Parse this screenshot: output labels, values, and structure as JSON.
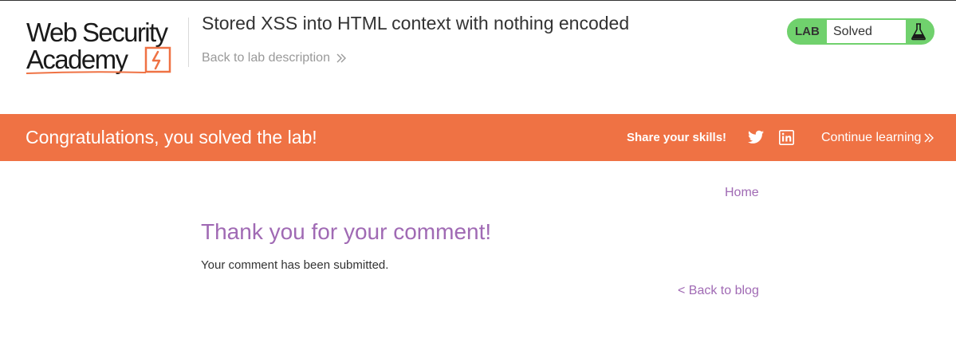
{
  "header": {
    "logo": {
      "line1": "Web Security",
      "line2": "Academy"
    },
    "lab_title": "Stored XSS into HTML context with nothing encoded",
    "back_to_description": "Back to lab description",
    "status": {
      "tag": "LAB",
      "text": "Solved",
      "icon": "flask-icon"
    }
  },
  "banner": {
    "message": "Congratulations, you solved the lab!",
    "share_label": "Share your skills!",
    "social_icons": [
      "twitter-icon",
      "linkedin-icon"
    ],
    "continue_label": "Continue learning"
  },
  "main": {
    "home_link": "Home",
    "heading": "Thank you for your comment!",
    "body": "Your comment has been submitted.",
    "back_to_blog": "< Back to blog"
  },
  "colors": {
    "banner": "#ef7244",
    "link": "#a06ab4",
    "status_green": "#70d16d",
    "logo_accent": "#ef7244"
  }
}
